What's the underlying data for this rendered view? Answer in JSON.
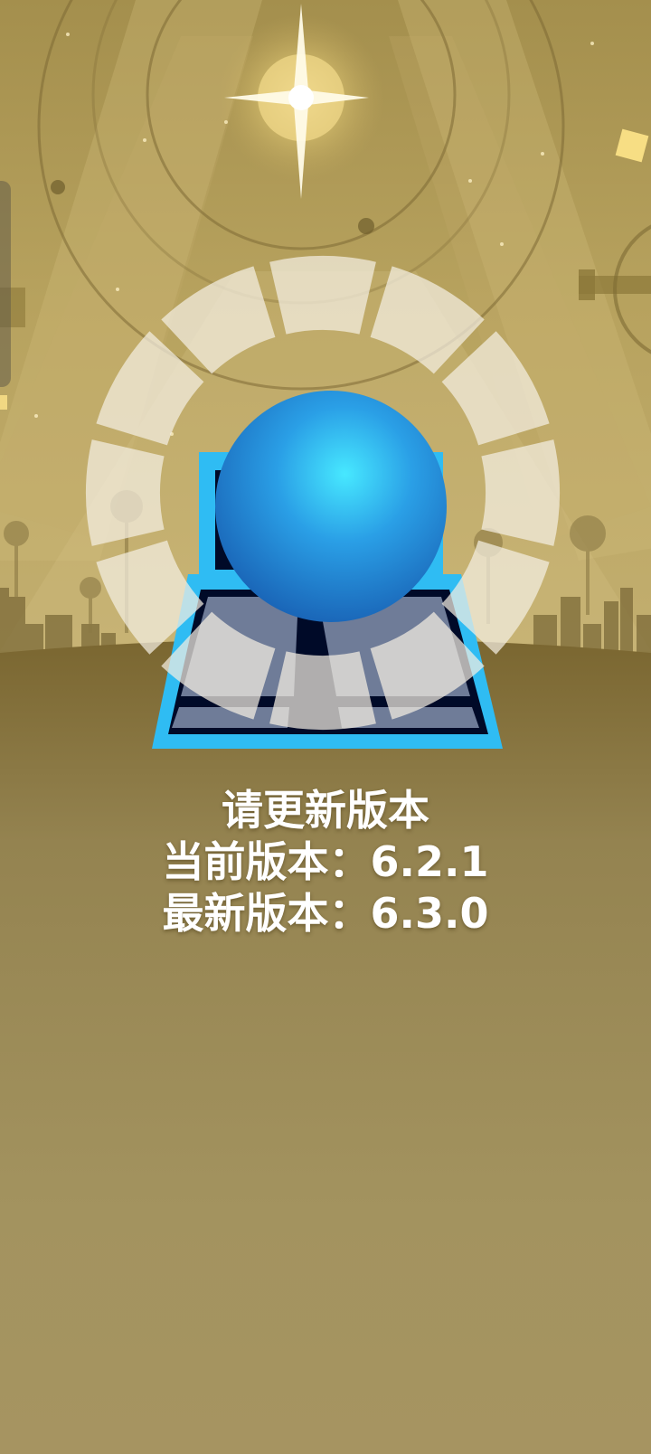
{
  "game": {
    "update_title": "请更新版本",
    "current_version_label": "当前版本：",
    "current_version": "6.2.1",
    "latest_version_label": "最新版本：",
    "latest_version": "6.3.0"
  },
  "colors": {
    "sky_gold": "#b9a45f",
    "ground_brown": "#8f7a3c",
    "ball_blue": "#1e7fd0",
    "tile_cyan": "#2fbcf3",
    "ring_white": "#f4efe2"
  },
  "icons": {
    "star": "sparkle-star-icon",
    "ball": "blue-ball-icon"
  }
}
